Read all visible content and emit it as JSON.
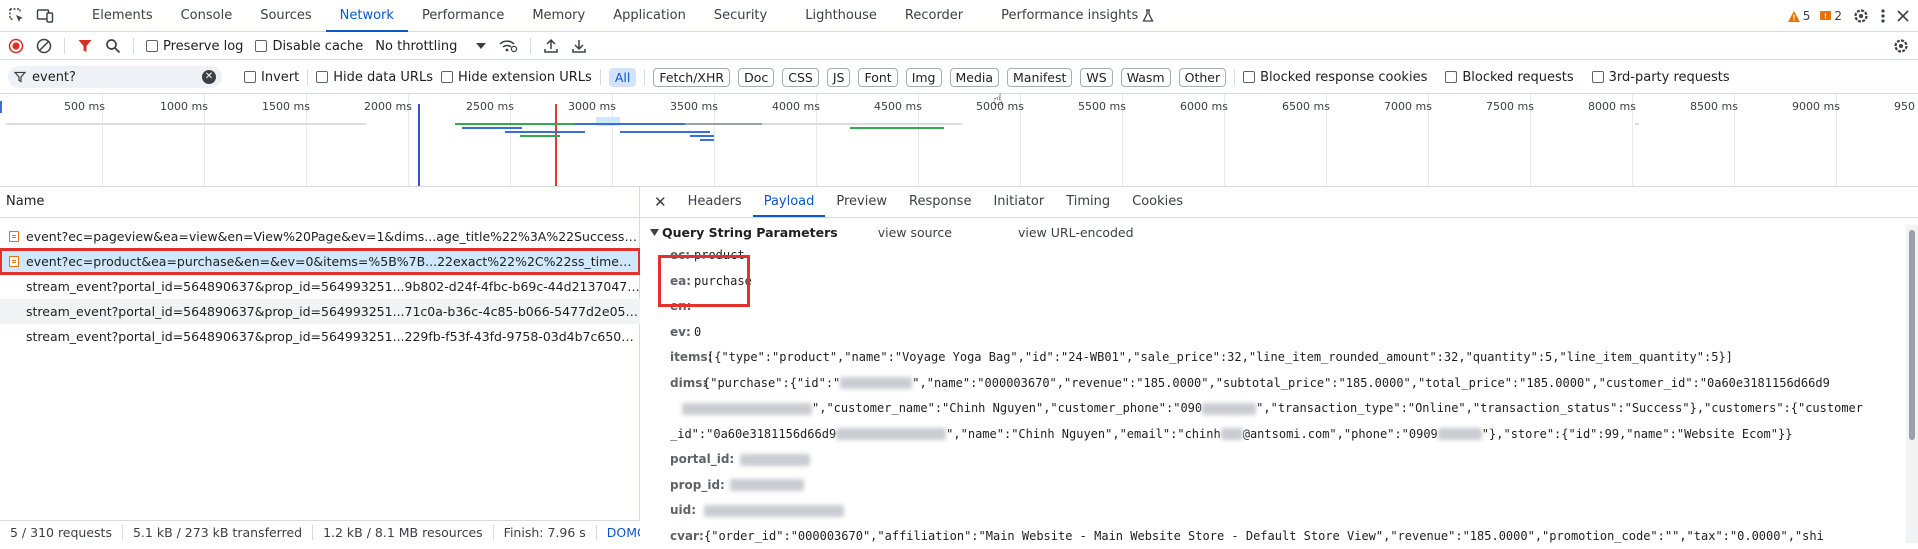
{
  "tabs": [
    {
      "label": "Elements"
    },
    {
      "label": "Console"
    },
    {
      "label": "Sources"
    },
    {
      "label": "Network"
    },
    {
      "label": "Performance"
    },
    {
      "label": "Memory"
    },
    {
      "label": "Application"
    },
    {
      "label": "Security"
    },
    {
      "label": "Lighthouse"
    },
    {
      "label": "Recorder"
    },
    {
      "label": "Performance insights"
    }
  ],
  "counts": {
    "warnings": "5",
    "issues": "2"
  },
  "toolbar": {
    "preserve_log": "Preserve log",
    "disable_cache": "Disable cache",
    "throttling": "No throttling"
  },
  "filter": {
    "value": "event?",
    "invert": "Invert",
    "hide_data_urls": "Hide data URLs",
    "hide_extension_urls": "Hide extension URLs",
    "types": [
      "All",
      "Fetch/XHR",
      "Doc",
      "CSS",
      "JS",
      "Font",
      "Img",
      "Media",
      "Manifest",
      "WS",
      "Wasm",
      "Other"
    ],
    "blocked_response_cookies": "Blocked response cookies",
    "blocked_requests": "Blocked requests",
    "third_party": "3rd-party requests"
  },
  "timeline": {
    "ticks": [
      "500 ms",
      "1000 ms",
      "1500 ms",
      "2000 ms",
      "2500 ms",
      "3000 ms",
      "3500 ms",
      "4000 ms",
      "4500 ms",
      "5000 ms",
      "5500 ms",
      "6000 ms",
      "6500 ms",
      "7000 ms",
      "7500 ms",
      "8000 ms",
      "8500 ms",
      "9000 ms",
      "950"
    ]
  },
  "requests": {
    "header": "Name",
    "rows": [
      "event?ec=pageview&ea=view&en=View%20Page&ev=1&dims...age_title%22%3A%22Success%2...",
      "event?ec=product&ea=purchase&en=&ev=0&items=%5B%7B...22exact%22%2C%22ss_time%22...",
      "stream_event?portal_id=564890637&prop_id=564993251...9b802-d24f-4fbc-b69c-44d213704798...",
      "stream_event?portal_id=564890637&prop_id=564993251...71c0a-b36c-4c85-b066-5477d2e05ae...",
      "stream_event?portal_id=564890637&prop_id=564993251...229fb-f53f-43fd-9758-03d4b7c650d8..."
    ]
  },
  "status": {
    "requests": "5 / 310 requests",
    "transferred": "5.1 kB / 273 kB transferred",
    "resources": "1.2 kB / 8.1 MB resources",
    "finish": "Finish: 7.96 s",
    "dom": "DOMCc"
  },
  "detail": {
    "tabs": [
      "Headers",
      "Payload",
      "Preview",
      "Response",
      "Initiator",
      "Timing",
      "Cookies"
    ],
    "section_title": "Query String Parameters",
    "view_source": "view source",
    "view_url_encoded": "view URL-encoded",
    "params": {
      "ec_key": "ec:",
      "ec_val": "product",
      "ea_key": "ea:",
      "ea_val": "purchase",
      "en_key": "en:",
      "ev_key": "ev:",
      "ev_val": "0",
      "items_key": "items:",
      "items_val": "[{\"type\":\"product\",\"name\":\"Voyage Yoga Bag\",\"id\":\"24-WB01\",\"sale_price\":32,\"line_item_rounded_amount\":32,\"quantity\":5,\"line_item_quantity\":5}]",
      "dims_key": "dims:",
      "dims_1a": "{\"purchase\":{\"id\":\"",
      "dims_1b": "\",\"name\":\"000003670\",\"revenue\":\"185.0000\",\"subtotal_price\":\"185.0000\",\"total_price\":\"185.0000\",\"customer_id\":\"0a60e3181156d66d9",
      "dims_2": "\",\"customer_name\":\"Chinh Nguyen\",\"customer_phone\":\"090",
      "dims_2b": "\",\"transaction_type\":\"Online\",\"transaction_status\":\"Success\"},\"customers\":{\"customer",
      "dims_3a": "_id\":\"0a60e3181156d66d9",
      "dims_3b": "\",\"name\":\"Chinh Nguyen\",\"email\":\"chinh",
      "dims_3c": "@antsomi.com\",\"phone\":\"0909",
      "dims_3d": "\"},\"store\":{\"id\":99,\"name\":\"Website Ecom\"}}",
      "portal_key": "portal_id:",
      "prop_key": "prop_id:",
      "uid_key": "uid:",
      "cvar_key": "cvar:",
      "cvar_val": "{\"order_id\":\"000003670\",\"affiliation\":\"Main Website - Main Website Store - Default Store View\",\"revenue\":\"185.0000\",\"promotion_code\":\"\",\"tax\":\"0.0000\",\"shi"
    }
  },
  "colors": {
    "accent": "#0b57d0",
    "highlight": "#e33131",
    "selected_row": "#cfe8fc"
  }
}
